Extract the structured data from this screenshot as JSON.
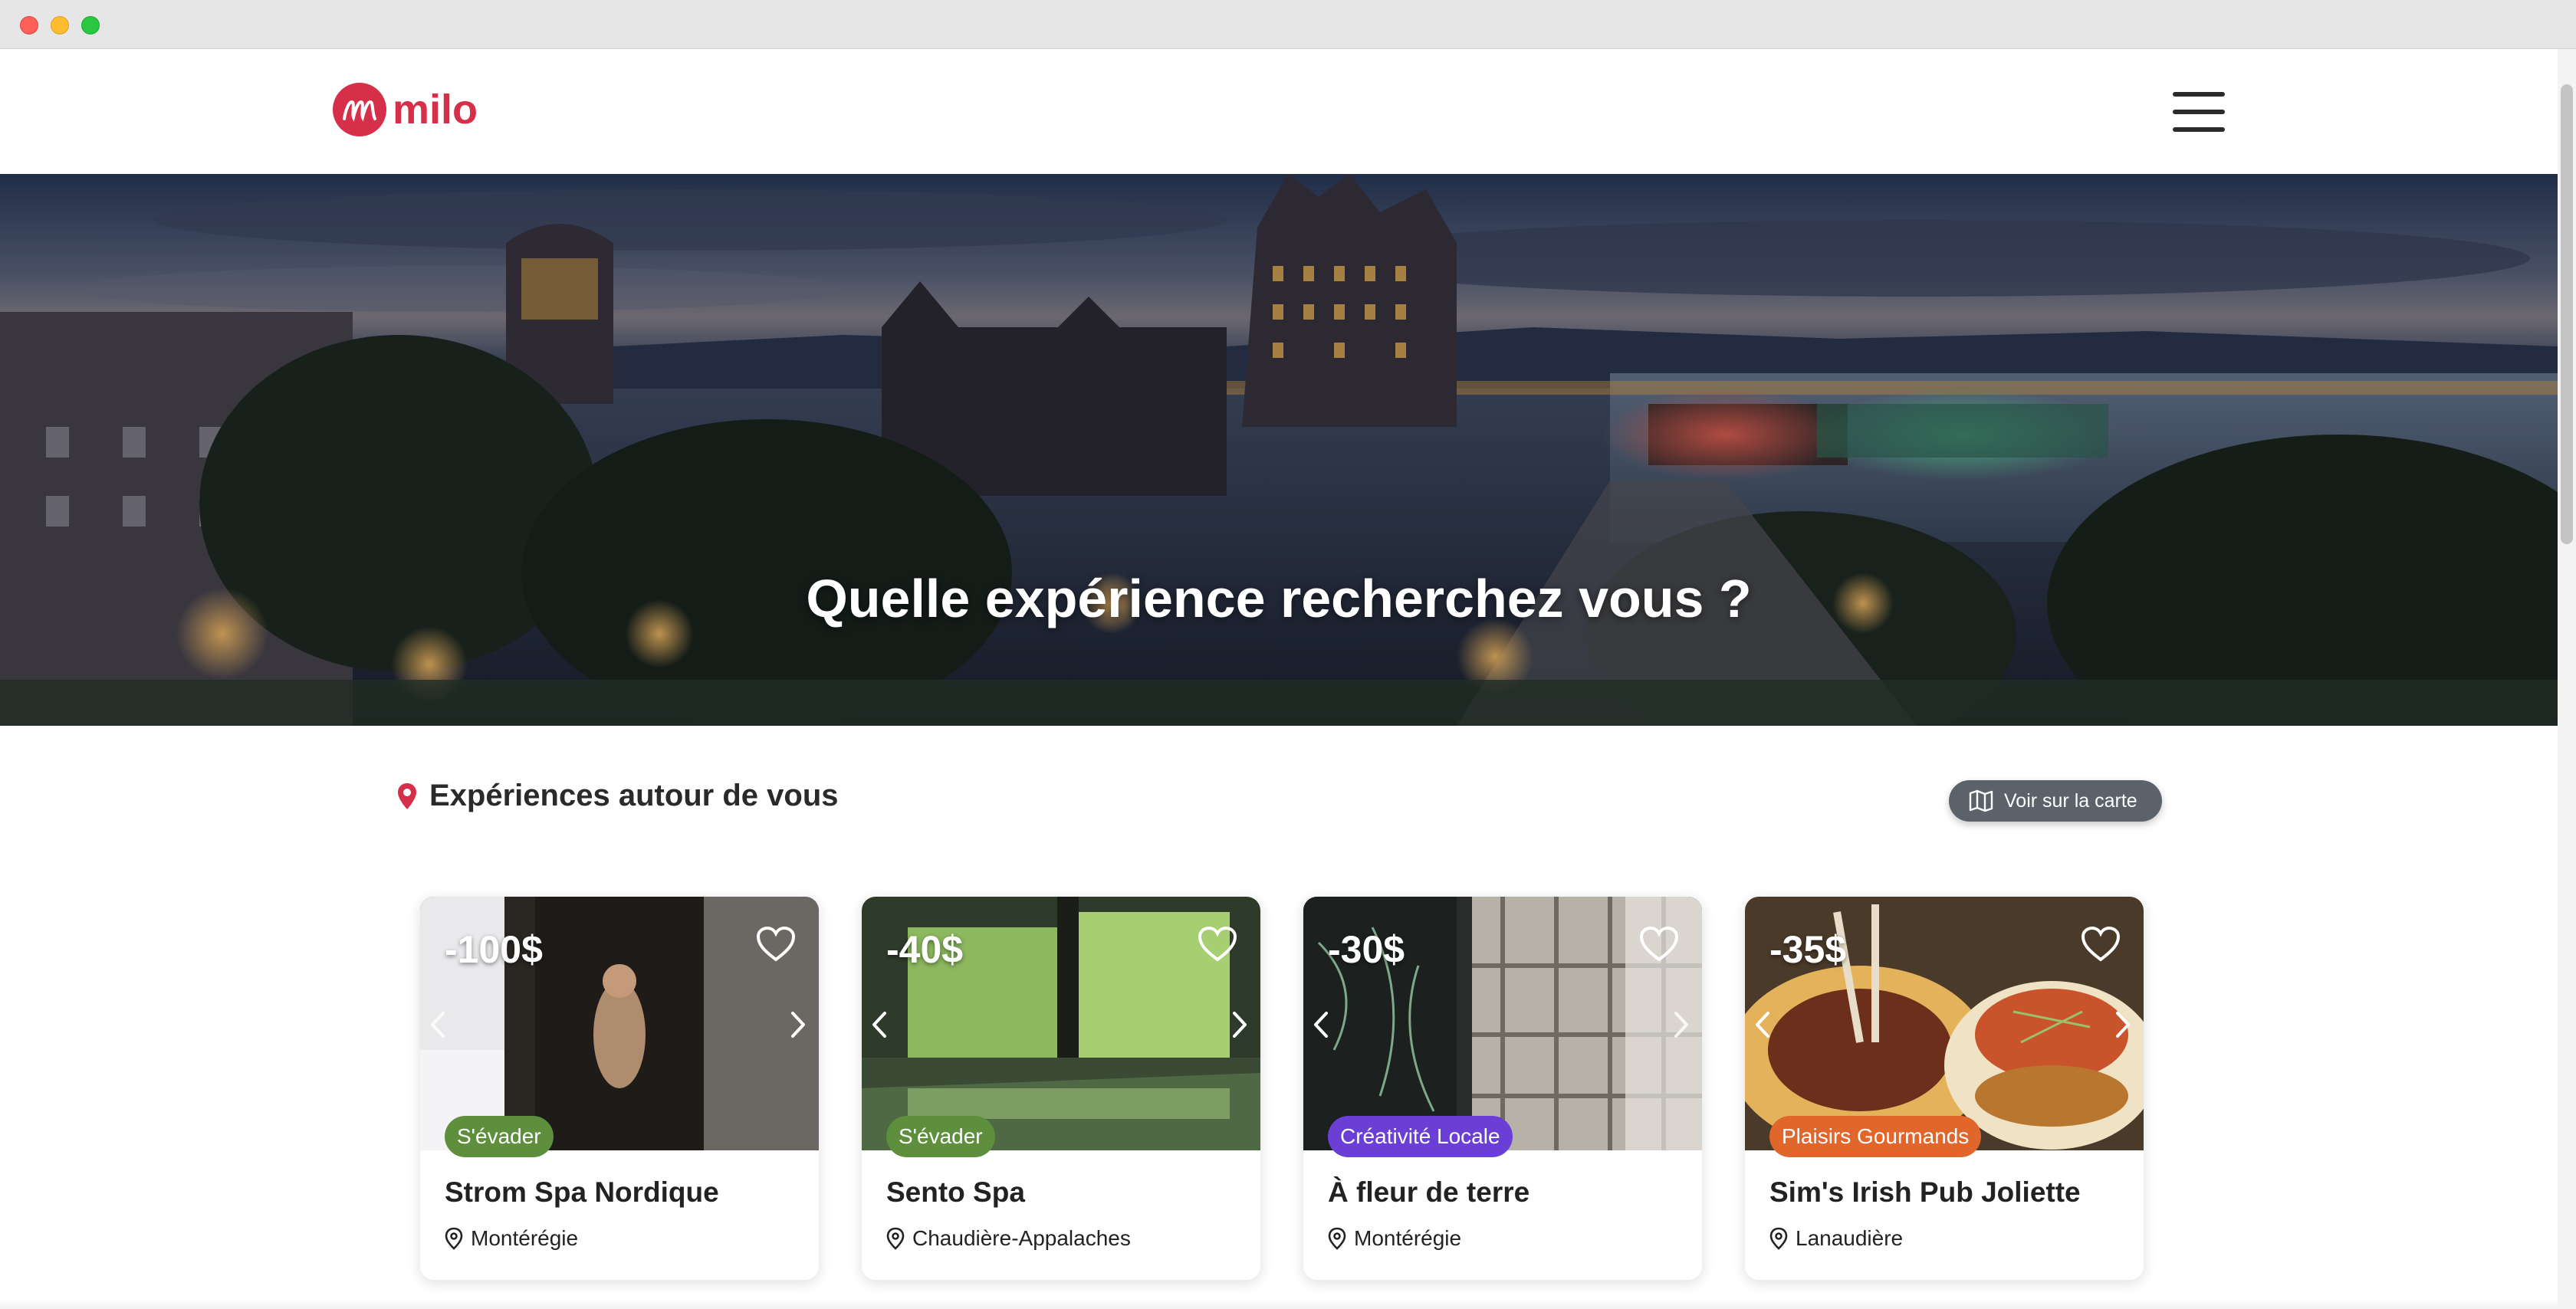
{
  "window": {
    "controls": [
      "close",
      "minimize",
      "zoom"
    ]
  },
  "header": {
    "logo_text": "milo",
    "logo_icon": "milo-logo-icon",
    "menu_icon": "hamburger-menu-icon"
  },
  "hero": {
    "title": "Quelle expérience recherchez vous ?"
  },
  "section": {
    "title": "Expériences autour de vous",
    "icon": "location-pin-icon",
    "map_button_label": "Voir sur la carte",
    "map_button_icon": "map-icon"
  },
  "colors": {
    "brand": "#d62f4a",
    "tag_green": "#5d8f3c",
    "tag_purple": "#6b3fd6",
    "tag_orange": "#e0662c",
    "button_grey": "#5c6269"
  },
  "cards": [
    {
      "discount": "-100$",
      "category": "S'évader",
      "name": "Strom Spa Nordique",
      "location": "Montérégie"
    },
    {
      "discount": "-40$",
      "category": "S'évader",
      "name": "Sento Spa",
      "location": "Chaudière-Appalaches"
    },
    {
      "discount": "-30$",
      "category": "Créativité Locale",
      "name": "À fleur de terre",
      "location": "Montérégie"
    },
    {
      "discount": "-35$",
      "category": "Plaisirs Gourmands",
      "name": "Sim's Irish Pub Joliette",
      "location": "Lanaudière"
    }
  ]
}
